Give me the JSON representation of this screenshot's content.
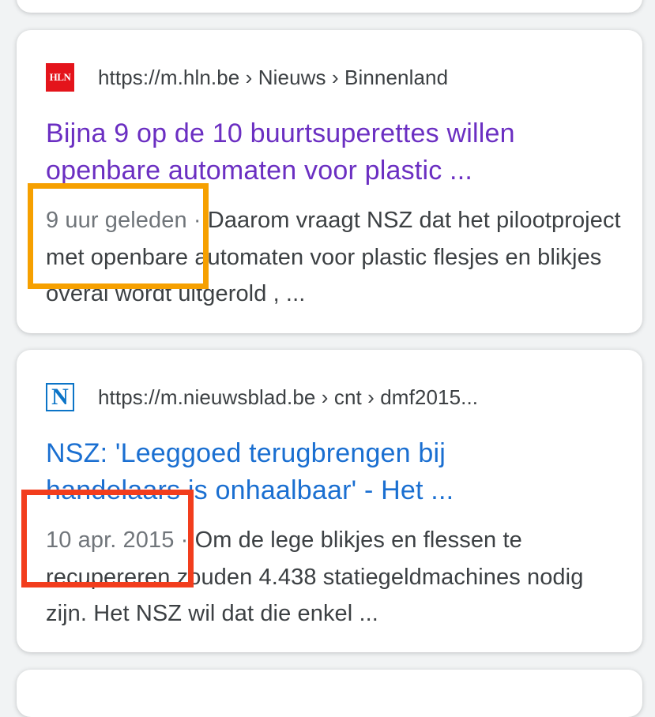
{
  "results": [
    {
      "favicon_text": "HLN",
      "url": "https://m.hln.be › Nieuws › Binnenland",
      "title_line1": "Bijna 9 op de 10 buurtsuperettes willen",
      "title_line2": "openbare automaten voor plastic ...",
      "date": "9 uur geleden",
      "separator": "·",
      "snippet_text": "Daarom vraagt NSZ dat het pilootproject met openbare automaten voor plastic flesjes en blikjes overal wordt uitgerold , ...",
      "visited": true
    },
    {
      "favicon_text": "N",
      "url": "https://m.nieuwsblad.be › cnt › dmf2015...",
      "title_line1": "NSZ: 'Leeggoed terugbrengen bij",
      "title_line2": "handelaars is onhaalbaar' - Het ...",
      "date": "10 apr. 2015",
      "separator": "·",
      "snippet_text": "Om de lege blikjes en flessen te recupereren zouden 4.438 statiegeldmachines nodig zijn. Het NSZ wil dat die enkel ...",
      "visited": false
    }
  ],
  "colors": {
    "visited_link": "#6b2fc2",
    "link": "#1a6fd1",
    "annotation_orange": "#f6a000",
    "annotation_red": "#f23d1d"
  }
}
